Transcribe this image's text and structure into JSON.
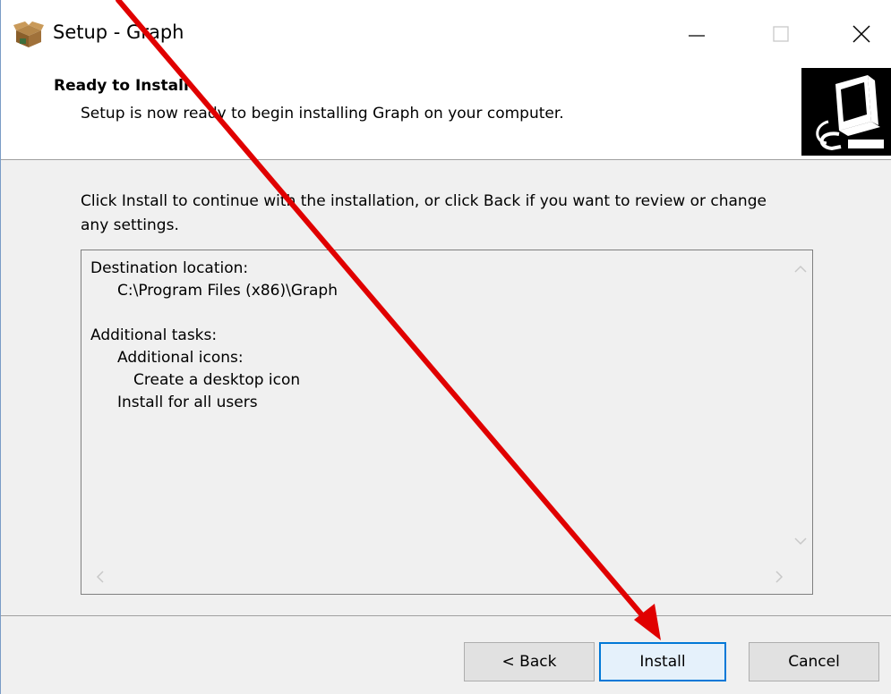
{
  "window": {
    "title": "Setup - Graph",
    "accent_color": "#0078d7"
  },
  "header": {
    "title": "Ready to Install",
    "subtitle": "Setup is now ready to begin installing Graph on your computer."
  },
  "body": {
    "instructions": "Click Install to continue with the installation, or click Back if you want to review or change any settings."
  },
  "memo": {
    "lines": [
      "Destination location:",
      "C:\\Program Files (x86)\\Graph",
      "Additional tasks:",
      "Additional icons:",
      "Create a desktop icon",
      "Install for all users"
    ]
  },
  "buttons": {
    "back": "< Back",
    "install": "Install",
    "cancel": "Cancel"
  },
  "annotation": {
    "arrow_color": "#e00000"
  }
}
